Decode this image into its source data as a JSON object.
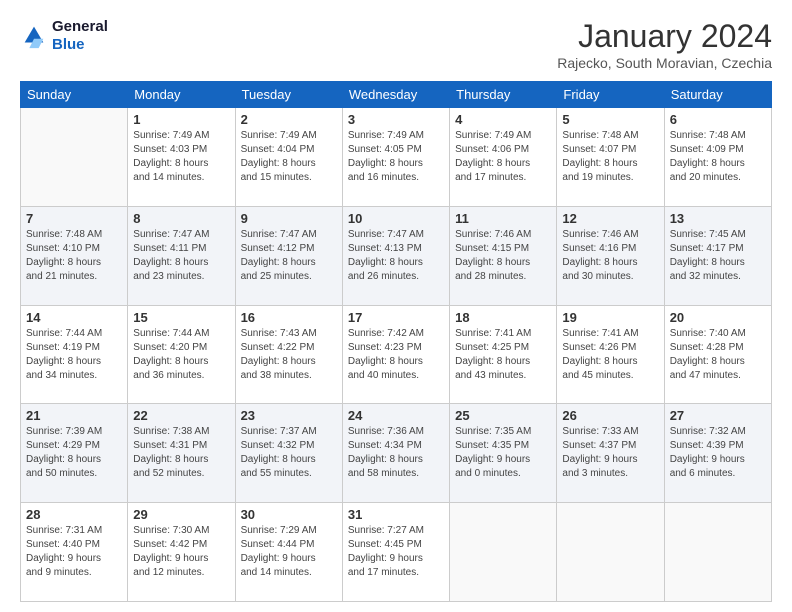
{
  "header": {
    "logo_line1": "General",
    "logo_line2": "Blue",
    "month": "January 2024",
    "location": "Rajecko, South Moravian, Czechia"
  },
  "weekdays": [
    "Sunday",
    "Monday",
    "Tuesday",
    "Wednesday",
    "Thursday",
    "Friday",
    "Saturday"
  ],
  "weeks": [
    [
      {
        "day": "",
        "info": ""
      },
      {
        "day": "1",
        "info": "Sunrise: 7:49 AM\nSunset: 4:03 PM\nDaylight: 8 hours\nand 14 minutes."
      },
      {
        "day": "2",
        "info": "Sunrise: 7:49 AM\nSunset: 4:04 PM\nDaylight: 8 hours\nand 15 minutes."
      },
      {
        "day": "3",
        "info": "Sunrise: 7:49 AM\nSunset: 4:05 PM\nDaylight: 8 hours\nand 16 minutes."
      },
      {
        "day": "4",
        "info": "Sunrise: 7:49 AM\nSunset: 4:06 PM\nDaylight: 8 hours\nand 17 minutes."
      },
      {
        "day": "5",
        "info": "Sunrise: 7:48 AM\nSunset: 4:07 PM\nDaylight: 8 hours\nand 19 minutes."
      },
      {
        "day": "6",
        "info": "Sunrise: 7:48 AM\nSunset: 4:09 PM\nDaylight: 8 hours\nand 20 minutes."
      }
    ],
    [
      {
        "day": "7",
        "info": "Sunrise: 7:48 AM\nSunset: 4:10 PM\nDaylight: 8 hours\nand 21 minutes."
      },
      {
        "day": "8",
        "info": "Sunrise: 7:47 AM\nSunset: 4:11 PM\nDaylight: 8 hours\nand 23 minutes."
      },
      {
        "day": "9",
        "info": "Sunrise: 7:47 AM\nSunset: 4:12 PM\nDaylight: 8 hours\nand 25 minutes."
      },
      {
        "day": "10",
        "info": "Sunrise: 7:47 AM\nSunset: 4:13 PM\nDaylight: 8 hours\nand 26 minutes."
      },
      {
        "day": "11",
        "info": "Sunrise: 7:46 AM\nSunset: 4:15 PM\nDaylight: 8 hours\nand 28 minutes."
      },
      {
        "day": "12",
        "info": "Sunrise: 7:46 AM\nSunset: 4:16 PM\nDaylight: 8 hours\nand 30 minutes."
      },
      {
        "day": "13",
        "info": "Sunrise: 7:45 AM\nSunset: 4:17 PM\nDaylight: 8 hours\nand 32 minutes."
      }
    ],
    [
      {
        "day": "14",
        "info": "Sunrise: 7:44 AM\nSunset: 4:19 PM\nDaylight: 8 hours\nand 34 minutes."
      },
      {
        "day": "15",
        "info": "Sunrise: 7:44 AM\nSunset: 4:20 PM\nDaylight: 8 hours\nand 36 minutes."
      },
      {
        "day": "16",
        "info": "Sunrise: 7:43 AM\nSunset: 4:22 PM\nDaylight: 8 hours\nand 38 minutes."
      },
      {
        "day": "17",
        "info": "Sunrise: 7:42 AM\nSunset: 4:23 PM\nDaylight: 8 hours\nand 40 minutes."
      },
      {
        "day": "18",
        "info": "Sunrise: 7:41 AM\nSunset: 4:25 PM\nDaylight: 8 hours\nand 43 minutes."
      },
      {
        "day": "19",
        "info": "Sunrise: 7:41 AM\nSunset: 4:26 PM\nDaylight: 8 hours\nand 45 minutes."
      },
      {
        "day": "20",
        "info": "Sunrise: 7:40 AM\nSunset: 4:28 PM\nDaylight: 8 hours\nand 47 minutes."
      }
    ],
    [
      {
        "day": "21",
        "info": "Sunrise: 7:39 AM\nSunset: 4:29 PM\nDaylight: 8 hours\nand 50 minutes."
      },
      {
        "day": "22",
        "info": "Sunrise: 7:38 AM\nSunset: 4:31 PM\nDaylight: 8 hours\nand 52 minutes."
      },
      {
        "day": "23",
        "info": "Sunrise: 7:37 AM\nSunset: 4:32 PM\nDaylight: 8 hours\nand 55 minutes."
      },
      {
        "day": "24",
        "info": "Sunrise: 7:36 AM\nSunset: 4:34 PM\nDaylight: 8 hours\nand 58 minutes."
      },
      {
        "day": "25",
        "info": "Sunrise: 7:35 AM\nSunset: 4:35 PM\nDaylight: 9 hours\nand 0 minutes."
      },
      {
        "day": "26",
        "info": "Sunrise: 7:33 AM\nSunset: 4:37 PM\nDaylight: 9 hours\nand 3 minutes."
      },
      {
        "day": "27",
        "info": "Sunrise: 7:32 AM\nSunset: 4:39 PM\nDaylight: 9 hours\nand 6 minutes."
      }
    ],
    [
      {
        "day": "28",
        "info": "Sunrise: 7:31 AM\nSunset: 4:40 PM\nDaylight: 9 hours\nand 9 minutes."
      },
      {
        "day": "29",
        "info": "Sunrise: 7:30 AM\nSunset: 4:42 PM\nDaylight: 9 hours\nand 12 minutes."
      },
      {
        "day": "30",
        "info": "Sunrise: 7:29 AM\nSunset: 4:44 PM\nDaylight: 9 hours\nand 14 minutes."
      },
      {
        "day": "31",
        "info": "Sunrise: 7:27 AM\nSunset: 4:45 PM\nDaylight: 9 hours\nand 17 minutes."
      },
      {
        "day": "",
        "info": ""
      },
      {
        "day": "",
        "info": ""
      },
      {
        "day": "",
        "info": ""
      }
    ]
  ]
}
